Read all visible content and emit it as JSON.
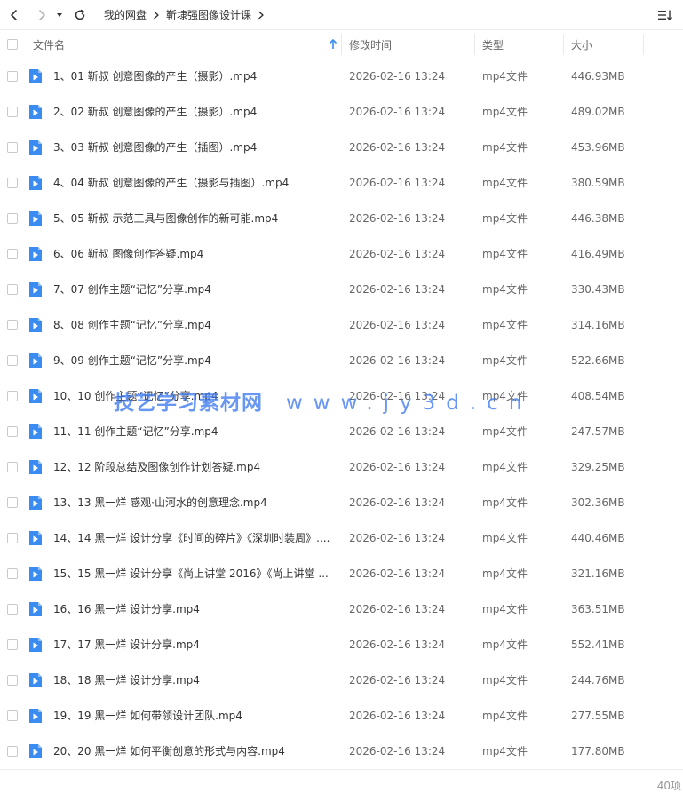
{
  "nav": {
    "breadcrumb": [
      "我的网盘",
      "靳埭强图像设计课"
    ]
  },
  "columns": {
    "name": "文件名",
    "modified": "修改时间",
    "type": "类型",
    "size": "大小"
  },
  "colors": {
    "accent": "#3b8cf0",
    "watermark": "#3c78f0"
  },
  "files": [
    {
      "name": "1、01 靳叔 创意图像的产生（摄影）.mp4",
      "modified": "2026-02-16 13:24",
      "type": "mp4文件",
      "size": "446.93MB"
    },
    {
      "name": "2、02 靳叔 创意图像的产生（摄影）.mp4",
      "modified": "2026-02-16 13:24",
      "type": "mp4文件",
      "size": "489.02MB"
    },
    {
      "name": "3、03 靳叔 创意图像的产生（插图）.mp4",
      "modified": "2026-02-16 13:24",
      "type": "mp4文件",
      "size": "453.96MB"
    },
    {
      "name": "4、04 靳叔 创意图像的产生（摄影与插图）.mp4",
      "modified": "2026-02-16 13:24",
      "type": "mp4文件",
      "size": "380.59MB"
    },
    {
      "name": "5、05 靳叔 示范工具与图像创作的新可能.mp4",
      "modified": "2026-02-16 13:24",
      "type": "mp4文件",
      "size": "446.38MB"
    },
    {
      "name": "6、06 靳叔 图像创作答疑.mp4",
      "modified": "2026-02-16 13:24",
      "type": "mp4文件",
      "size": "416.49MB"
    },
    {
      "name": "7、07  创作主题“记忆”分享.mp4",
      "modified": "2026-02-16 13:24",
      "type": "mp4文件",
      "size": "330.43MB"
    },
    {
      "name": "8、08 创作主题“记忆”分享.mp4",
      "modified": "2026-02-16 13:24",
      "type": "mp4文件",
      "size": "314.16MB"
    },
    {
      "name": "9、09 创作主题“记忆”分享.mp4",
      "modified": "2026-02-16 13:24",
      "type": "mp4文件",
      "size": "522.66MB"
    },
    {
      "name": "10、10 创作主题“记忆”分享.mp4",
      "modified": "2026-02-16 13:24",
      "type": "mp4文件",
      "size": "408.54MB"
    },
    {
      "name": "11、11 创作主题“记忆”分享.mp4",
      "modified": "2026-02-16 13:24",
      "type": "mp4文件",
      "size": "247.57MB"
    },
    {
      "name": "12、12 阶段总结及图像创作计划答疑.mp4",
      "modified": "2026-02-16 13:24",
      "type": "mp4文件",
      "size": "329.25MB"
    },
    {
      "name": "13、13 黑一烊 感观·山河水的创意理念.mp4",
      "modified": "2026-02-16 13:24",
      "type": "mp4文件",
      "size": "302.36MB"
    },
    {
      "name": "14、14 黑一烊 设计分享《时间的碎片》《深圳时装周》....",
      "modified": "2026-02-16 13:24",
      "type": "mp4文件",
      "size": "440.46MB"
    },
    {
      "name": "15、15 黑一烊 设计分享《尚上讲堂 2016》《尚上讲堂 ...",
      "modified": "2026-02-16 13:24",
      "type": "mp4文件",
      "size": "321.16MB"
    },
    {
      "name": "16、16 黑一烊 设计分享.mp4",
      "modified": "2026-02-16 13:24",
      "type": "mp4文件",
      "size": "363.51MB"
    },
    {
      "name": "17、17 黑一烊 设计分享.mp4",
      "modified": "2026-02-16 13:24",
      "type": "mp4文件",
      "size": "552.41MB"
    },
    {
      "name": "18、18 黑一烊 设计分享.mp4",
      "modified": "2026-02-16 13:24",
      "type": "mp4文件",
      "size": "244.76MB"
    },
    {
      "name": "19、19 黑一烊 如何带领设计团队.mp4",
      "modified": "2026-02-16 13:24",
      "type": "mp4文件",
      "size": "277.55MB"
    },
    {
      "name": "20、20 黑一烊 如何平衡创意的形式与内容.mp4",
      "modified": "2026-02-16 13:24",
      "type": "mp4文件",
      "size": "177.80MB"
    }
  ],
  "watermark": {
    "part1": "技艺学习素材网",
    "part2": "www.jy3d.cn"
  },
  "footer": {
    "count": "40项"
  },
  "icons": {
    "back": "chevron-left-icon",
    "forward": "chevron-right-icon",
    "dropdown": "caret-down-icon",
    "refresh": "refresh-icon",
    "breadcrumb_separator": "chevron-right-icon",
    "view_toggle": "sort-list-icon",
    "sort": "arrow-up-icon",
    "file": "video-file-icon"
  }
}
